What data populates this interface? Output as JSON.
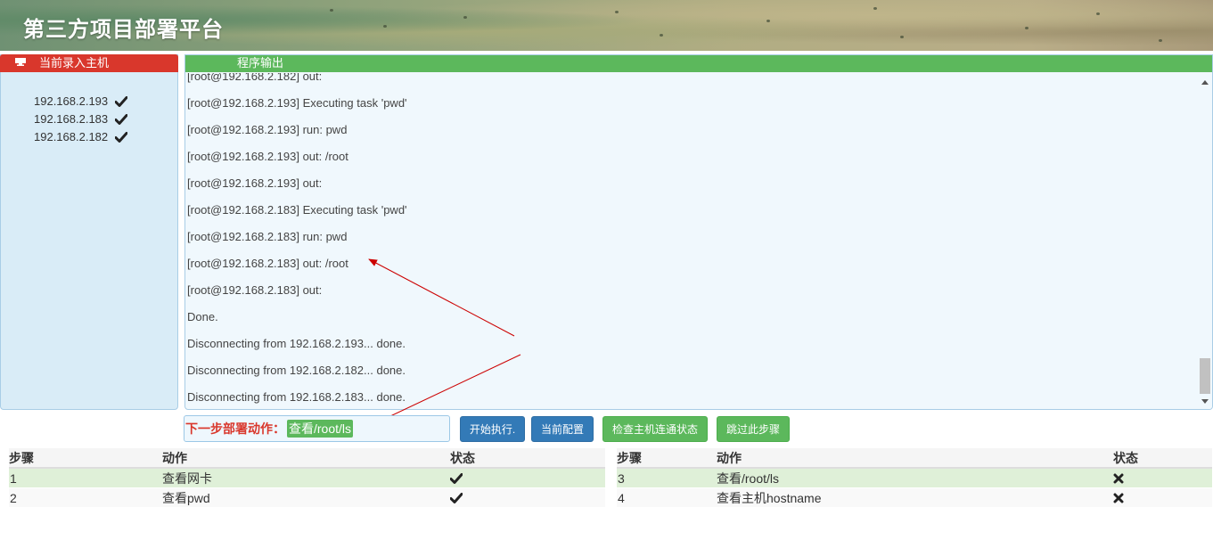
{
  "header": {
    "title": "第三方项目部署平台"
  },
  "hosts_panel": {
    "title": "当前录入主机",
    "hosts": [
      "192.168.2.193",
      "192.168.2.183",
      "192.168.2.182"
    ]
  },
  "output_panel": {
    "title": "程序输出",
    "lines": [
      "[root@192.168.2.182] out:",
      "[root@192.168.2.193] Executing task 'pwd'",
      "[root@192.168.2.193] run: pwd",
      "[root@192.168.2.193] out: /root",
      "[root@192.168.2.193] out:",
      "[root@192.168.2.183] Executing task 'pwd'",
      "[root@192.168.2.183] run: pwd",
      "[root@192.168.2.183] out: /root",
      "[root@192.168.2.183] out:",
      "Done.",
      "Disconnecting from 192.168.2.193... done.",
      "Disconnecting from 192.168.2.182... done.",
      "Disconnecting from 192.168.2.183... done."
    ]
  },
  "next_action": {
    "label": "下一步部署动作：",
    "value": "查看/root/ls"
  },
  "buttons": {
    "start": "开始执行.",
    "config": "当前配置",
    "check": "检查主机连通状态",
    "skip": "跳过此步骤"
  },
  "steps_table": {
    "headers": [
      "步骤",
      "动作",
      "状态"
    ],
    "left": [
      {
        "step": "1",
        "action": "查看网卡",
        "status": "done"
      },
      {
        "step": "2",
        "action": "查看pwd",
        "status": "done"
      }
    ],
    "right": [
      {
        "step": "3",
        "action": "查看/root/ls",
        "status": "pending"
      },
      {
        "step": "4",
        "action": "查看主机hostname",
        "status": "pending"
      }
    ]
  },
  "colors": {
    "hosts_header": "#d9372c",
    "output_header": "#5cb85c",
    "button_blue": "#337ab7",
    "button_green": "#5cb85c",
    "next_label": "#d9372c",
    "row_highlight": "#dff0d8"
  }
}
